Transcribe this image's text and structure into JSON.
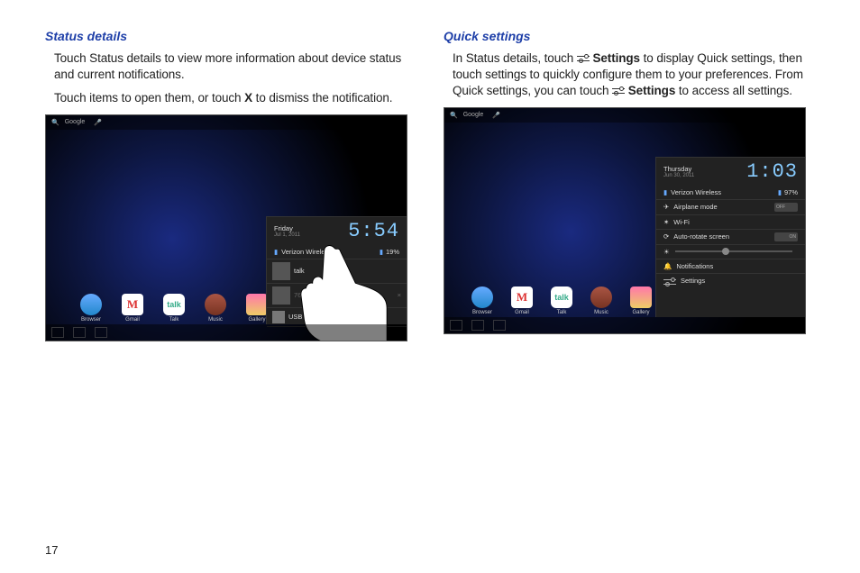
{
  "left": {
    "heading": "Status details",
    "para1": "Touch Status details to view more information about device status and current notifications.",
    "para2_a": "Touch items to open them, or touch ",
    "para2_b": "X",
    "para2_c": "  to dismiss the notification."
  },
  "right": {
    "heading": "Quick settings",
    "para1_a": "In Status details, touch ",
    "para1_b": "Settings",
    "para1_c": " to display Quick settings, then touch settings to quickly configure them to your preferences. From Quick settings, you can touch ",
    "para1_d": "Settings",
    "para1_e": " to access all settings."
  },
  "shot": {
    "google": "Google",
    "apps": {
      "browser": "Browser",
      "gmail": "Gmail",
      "talk_icon": "talk",
      "talk": "Talk",
      "music": "Music",
      "gallery": "Gallery"
    }
  },
  "status_panel": {
    "day": "Friday",
    "date": "Jul 1, 2011",
    "clock": "5:54",
    "carrier": "Verizon Wireless",
    "battery": "19%",
    "n1": "talk",
    "n2": "766",
    "n3": "USB debugging..."
  },
  "quick_panel": {
    "day": "Thursday",
    "date": "Jun 30, 2011",
    "clock": "1:03",
    "carrier": "Verizon Wireless",
    "battery": "97%",
    "airplane": "Airplane mode",
    "wifi": "Wi-Fi",
    "autorotate": "Auto-rotate screen",
    "brightness": "",
    "notifications": "Notifications",
    "settings": "Settings",
    "off": "OFF",
    "on": "ON"
  },
  "page_number": "17"
}
